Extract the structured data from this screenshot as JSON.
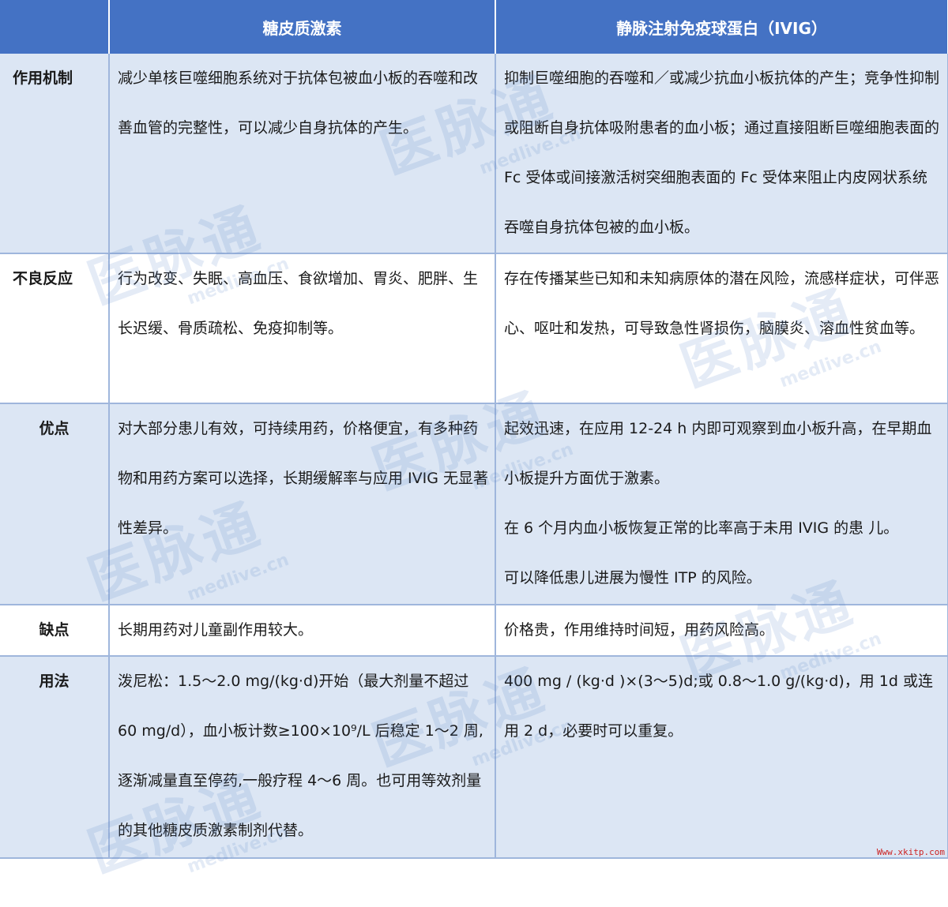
{
  "header": {
    "corner": "",
    "col1": "糖皮质激素",
    "col2": "静脉注射免疫球蛋白（IVIG）"
  },
  "rows": [
    {
      "label": "作用机制",
      "col1": [
        "减少单核巨噬细胞系统对于抗体包被血小板的吞噬和改善血管的完整性，可以减少自身抗体的产生。"
      ],
      "col2": [
        "抑制巨噬细胞的吞噬和／或减少抗血小板抗体的产生；竞争性抑制或阻断自身抗体吸附患者的血小板；通过直接阻断巨噬细胞表面的 Fc 受体或间接激活树突细胞表面的 Fc 受体来阻止内皮网状系统吞噬自身抗体包被的血小板。"
      ]
    },
    {
      "label": "不良反应",
      "col1": [
        "行为改变、失眠、高血压、食欲增加、胃炎、肥胖、生长迟缓、骨质疏松、免疫抑制等。"
      ],
      "col2": [
        "存在传播某些已知和未知病原体的潜在风险，流感样症状，可伴恶心、呕吐和发热，可导致急性肾损伤，脑膜炎、溶血性贫血等。"
      ]
    },
    {
      "label": "优点",
      "col1": [
        "对大部分患儿有效，可持续用药，价格便宜，有多种药物和用药方案可以选择，长期缓解率与应用 IVIG 无显著性差异。"
      ],
      "col2": [
        "起效迅速，在应用 12-24 h 内即可观察到血小板升高，在早期血小板提升方面优于激素。",
        "在 6 个月内血小板恢复正常的比率高于未用 IVIG 的患 儿。",
        "可以降低患儿进展为慢性 ITP 的风险。"
      ]
    },
    {
      "label": "缺点",
      "col1": [
        "长期用药对儿童副作用较大。"
      ],
      "col2": [
        "价格贵，作用维持时间短，用药风险高。"
      ]
    },
    {
      "label": "用法",
      "col1": [
        "泼尼松：1.5～2.0 mg/(kg·d)开始（最大剂量不超过 60 mg/d），血小板计数≥100×10⁹/L 后稳定 1～2 周,逐渐减量直至停药,一般疗程 4～6 周。也可用等效剂量的其他糖皮质激素制剂代替。"
      ],
      "col2": [
        "400 mg / (kg·d )×(3～5)d;或 0.8～1.0 g/(kg·d)，用 1d 或连用 2 d，必要时可以重复。"
      ]
    }
  ],
  "watermark": {
    "text": "医脉通",
    "subtext": "medlive.cn"
  },
  "footer_url": "Www.xkitp.com"
}
